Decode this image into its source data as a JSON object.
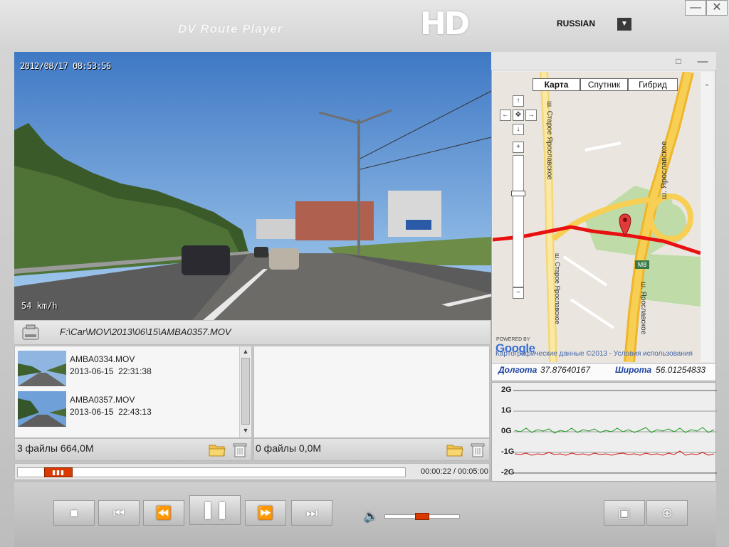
{
  "app": {
    "title": "DV Route Player",
    "logo": "HD",
    "language": "RUSSIAN",
    "lang_icon": "double-chevron-down-icon",
    "minimize_icon": "minimize-icon",
    "close_icon": "close-icon"
  },
  "video": {
    "timestamp": "2012/08/17 08:53:56",
    "speed": "54 km/h"
  },
  "file_path": "F:\\Car\\MOV\\2013\\06\\15\\AMBA0357.MOV",
  "file_list": {
    "items": [
      {
        "name": "AMBA0334.MOV",
        "date": "2013-06-15",
        "time": "22:31:38"
      },
      {
        "name": "AMBA0357.MOV",
        "date": "2013-06-15",
        "time": "22:43:13"
      }
    ],
    "left_summary": "3 файлы 664,0M",
    "right_summary": "0 файлы 0,0M"
  },
  "playback": {
    "current_time": "00:00:22",
    "total_time": "00:05:00",
    "time_display": "00:00:22 / 00:05:00",
    "progress_fraction": 0.073,
    "volume_fraction": 0.5
  },
  "map": {
    "tabs": [
      "Карта",
      "Спутник",
      "Гибрид"
    ],
    "active_tab": "Карта",
    "streets": {
      "old_yaroslavl": "ш. Старое Ярославское",
      "yaroslavl": "ш. Ярославское",
      "route_badge": "M8"
    },
    "powered_by": "POWERED BY",
    "google_logo": "Google",
    "copyright": "Картографические данные ©2013 - Условия использования"
  },
  "coordinates": {
    "longitude_label": "Долгота",
    "longitude_value": "37.87640167",
    "latitude_label": "Широта",
    "latitude_value": "56.01254833"
  },
  "gsensor": {
    "labels": [
      "2G",
      "1G",
      "0G",
      "-1G",
      "-2G"
    ],
    "colors": {
      "green": "#1a9a1a",
      "red": "#d01010"
    }
  },
  "controls": {
    "stop_icon": "stop-icon",
    "prev_icon": "skip-previous-icon",
    "rewind_icon": "rewind-icon",
    "pause_icon": "pause-icon",
    "forward_icon": "fast-forward-icon",
    "next_icon": "skip-next-icon",
    "volume_icon": "volume-icon",
    "snapshot_icon": "camera-icon",
    "zoom_icon": "zoom-in-icon"
  },
  "colors": {
    "accent": "#d93a00",
    "map_route": "#e81010",
    "label_blue": "#1a3fa0"
  }
}
